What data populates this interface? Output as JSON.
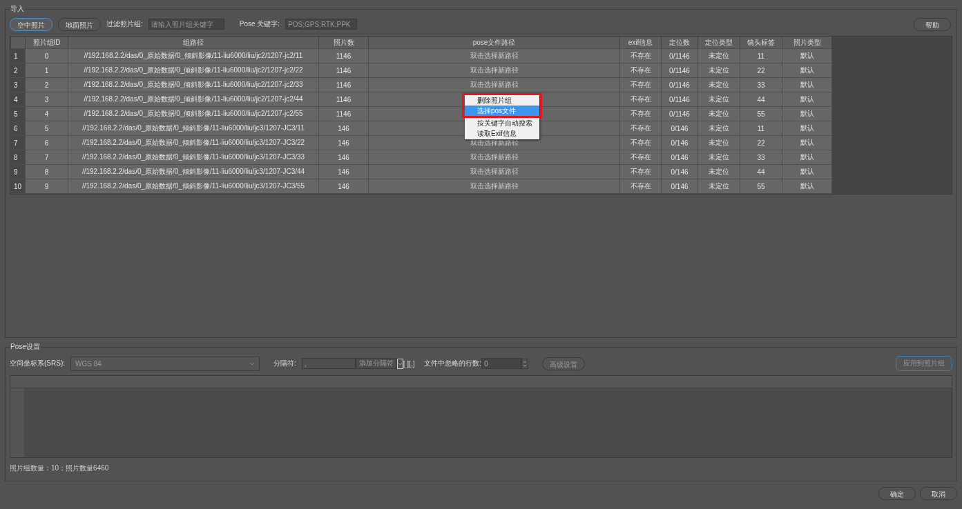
{
  "import_group": {
    "title": "导入",
    "photo_buttons": [
      {
        "label": "空中照片",
        "selected": true
      },
      {
        "label": "地面照片",
        "selected": false
      }
    ],
    "filter_label": "过滤照片组:",
    "filter_placeholder": "请输入照片组关键字",
    "pose_keyword_label": "Pose 关键字:",
    "pose_keyword_placeholder": "POS;GPS;RTK;PPK",
    "help_button": "帮助"
  },
  "table": {
    "columns": [
      "照片组ID",
      "组路径",
      "照片数",
      "pose文件路径",
      "exif信息",
      "定位数",
      "定位类型",
      "镜头标签",
      "照片类型"
    ],
    "rows": [
      {
        "n": "1",
        "cells": [
          "0",
          "//192.168.2.2/das/0_原始数据/0_倾斜影像/11-liu6000/liu/jc2/1207-jc2/11",
          "1146",
          "双击选择新路径",
          "不存在",
          "0/1146",
          "未定位",
          "11",
          "默认"
        ]
      },
      {
        "n": "2",
        "cells": [
          "1",
          "//192.168.2.2/das/0_原始数据/0_倾斜影像/11-liu6000/liu/jc2/1207-jc2/22",
          "1146",
          "双击选择新路径",
          "不存在",
          "0/1146",
          "未定位",
          "22",
          "默认"
        ]
      },
      {
        "n": "3",
        "cells": [
          "2",
          "//192.168.2.2/das/0_原始数据/0_倾斜影像/11-liu6000/liu/jc2/1207-jc2/33",
          "1146",
          "双击选择新路径",
          "不存在",
          "0/1146",
          "未定位",
          "33",
          "默认"
        ]
      },
      {
        "n": "4",
        "cells": [
          "3",
          "//192.168.2.2/das/0_原始数据/0_倾斜影像/11-liu6000/liu/jc2/1207-jc2/44",
          "1146",
          null,
          "不存在",
          "0/1146",
          "未定位",
          "44",
          "默认"
        ]
      },
      {
        "n": "5",
        "cells": [
          "4",
          "//192.168.2.2/das/0_原始数据/0_倾斜影像/11-liu6000/liu/jc2/1207-jc2/55",
          "1146",
          null,
          "不存在",
          "0/1146",
          "未定位",
          "55",
          "默认"
        ]
      },
      {
        "n": "6",
        "cells": [
          "5",
          "//192.168.2.2/das/0_原始数据/0_倾斜影像/11-liu6000/liu/jc3/1207-JC3/11",
          "146",
          null,
          "不存在",
          "0/146",
          "未定位",
          "11",
          "默认"
        ]
      },
      {
        "n": "7",
        "cells": [
          "6",
          "//192.168.2.2/das/0_原始数据/0_倾斜影像/11-liu6000/liu/jc3/1207-JC3/22",
          "146",
          "双击选择新路径",
          "不存在",
          "0/146",
          "未定位",
          "22",
          "默认"
        ]
      },
      {
        "n": "8",
        "cells": [
          "7",
          "//192.168.2.2/das/0_原始数据/0_倾斜影像/11-liu6000/liu/jc3/1207-JC3/33",
          "146",
          "双击选择新路径",
          "不存在",
          "0/146",
          "未定位",
          "33",
          "默认"
        ]
      },
      {
        "n": "9",
        "cells": [
          "8",
          "//192.168.2.2/das/0_原始数据/0_倾斜影像/11-liu6000/liu/jc3/1207-JC3/44",
          "146",
          "双击选择新路径",
          "不存在",
          "0/146",
          "未定位",
          "44",
          "默认"
        ]
      },
      {
        "n": "10",
        "cells": [
          "9",
          "//192.168.2.2/das/0_原始数据/0_倾斜影像/11-liu6000/liu/jc3/1207-JC3/55",
          "146",
          "双击选择新路径",
          "不存在",
          "0/146",
          "未定位",
          "55",
          "默认"
        ]
      }
    ]
  },
  "context_menu": {
    "items": [
      {
        "label": "删除照片组",
        "selected": false
      },
      {
        "label": "选择pos文件",
        "selected": true
      },
      {
        "label": "按关键字自动搜索",
        "selected": false
      },
      {
        "label": "读取Exif信息",
        "selected": false
      }
    ]
  },
  "pose_group": {
    "title": "Pose设置",
    "srs_label": "空间坐标系(SRS):",
    "srs_value": "WGS 84",
    "separator_label": "分隔符:",
    "separator_value": ",",
    "add_separator": "添加分隔符",
    "separator_display": "[ ][,]",
    "skip_lines_label": "文件中忽略的行数:",
    "skip_lines_value": "0",
    "advanced_button": "高级设置",
    "apply_button": "应用到照片组"
  },
  "status": "照片组数量：10；照片数量6460",
  "buttons": [
    "确定",
    "取消"
  ]
}
